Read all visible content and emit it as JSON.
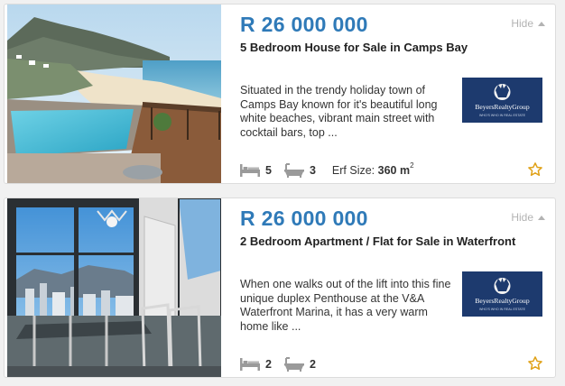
{
  "listings": [
    {
      "price": "R 26 000 000",
      "title": "5 Bedroom House for Sale in Camps Bay",
      "description": "Situated in the trendy holiday town of Camps Bay known for it's beautiful long white beaches, vibrant main street with cocktail bars, top ...",
      "hide_label": "Hide",
      "bedrooms": "5",
      "bathrooms": "3",
      "erf_label": "Erf Size:",
      "erf_value": "360 m",
      "erf_unit_exp": "2",
      "agency_name": "BeyersRealtyGroup",
      "agency_tagline": "WHO'S WHO IN REAL ESTATE",
      "icons": [
        "bed-icon",
        "bath-icon",
        "star-icon"
      ]
    },
    {
      "price": "R 26 000 000",
      "title": "2 Bedroom Apartment / Flat for Sale in Waterfront",
      "description": "When one walks out of the lift into this fine unique duplex Penthouse at the V&A Waterfront Marina, it has a very warm home like ...",
      "hide_label": "Hide",
      "bedrooms": "2",
      "bathrooms": "2",
      "agency_name": "BeyersRealtyGroup",
      "agency_tagline": "WHO'S WHO IN REAL ESTATE",
      "icons": [
        "bed-icon",
        "bath-icon",
        "star-icon"
      ]
    }
  ],
  "colors": {
    "price": "#2f7ab8",
    "agency_bg": "#1d3a6e",
    "star": "#e0a21a",
    "muted": "#b3b3b3"
  }
}
